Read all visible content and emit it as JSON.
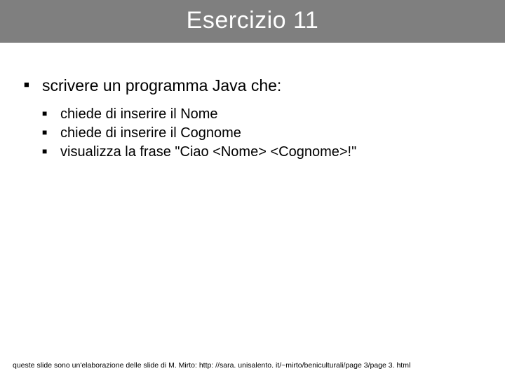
{
  "title": "Esercizio 11",
  "main_bullet": "scrivere un programma Java che:",
  "sub_bullets": [
    "chiede di inserire il Nome",
    "chiede di inserire il Cognome",
    "visualizza la frase \"Ciao <Nome> <Cognome>!\""
  ],
  "footer": "queste slide sono un'elaborazione delle slide di M. Mirto: http: //sara. unisalento. it/~mirto/beniculturali/page 3/page 3. html"
}
